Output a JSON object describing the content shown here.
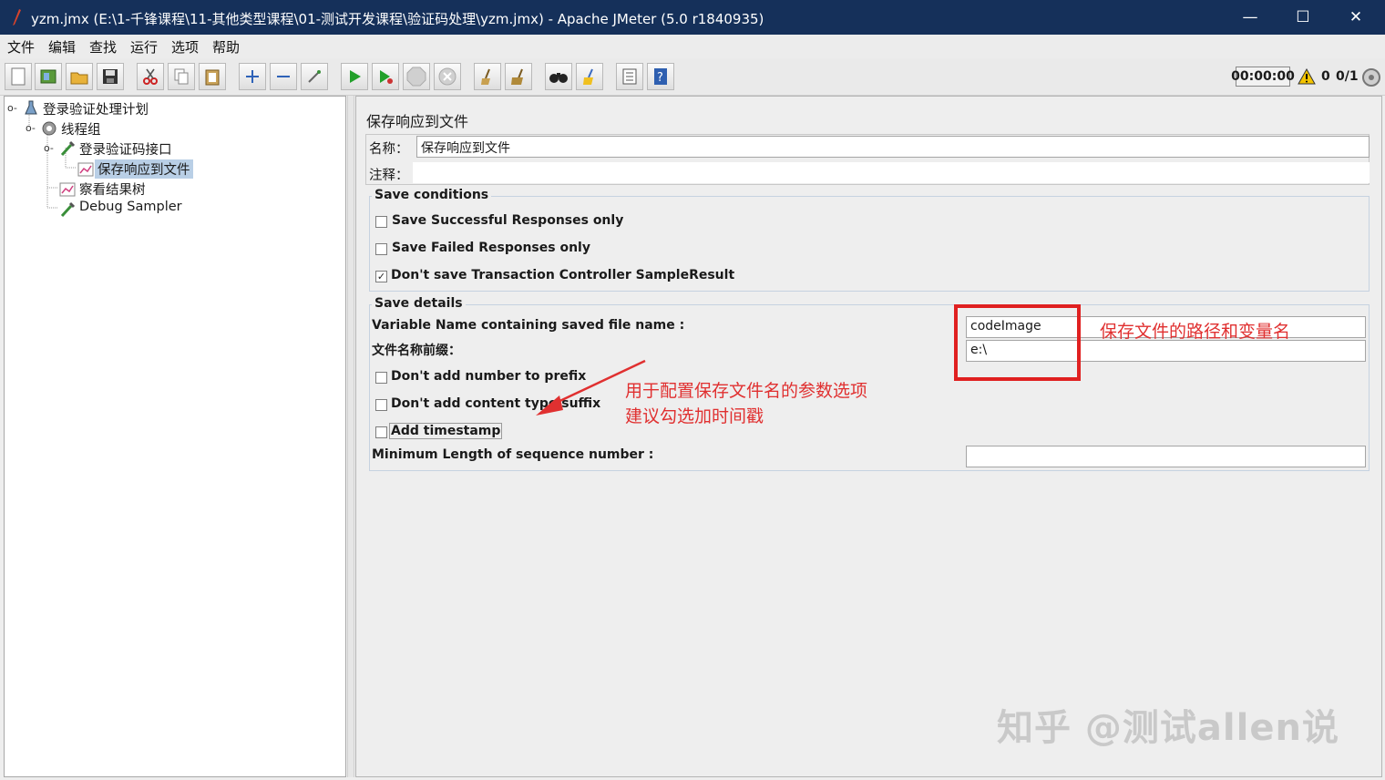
{
  "window": {
    "title": "yzm.jmx (E:\\1-千锋课程\\11-其他类型课程\\01-测试开发课程\\验证码处理\\yzm.jmx) - Apache JMeter (5.0 r1840935)",
    "minimize": "—",
    "maximize": "☐",
    "close": "✕"
  },
  "menu": [
    "文件",
    "编辑",
    "查找",
    "运行",
    "选项",
    "帮助"
  ],
  "toolbar": {
    "timer": "00:00:00",
    "warning_count": "0",
    "thread_count": "0/1"
  },
  "tree": {
    "nodes": [
      "登录验证处理计划",
      "线程组",
      "登录验证码接口",
      "保存响应到文件",
      "察看结果树",
      "Debug Sampler"
    ]
  },
  "panel": {
    "header": "保存响应到文件",
    "name_label": "名称：",
    "name_value": "保存响应到文件",
    "comment_label": "注释：",
    "save_conditions": {
      "legend": "Save conditions",
      "options": [
        {
          "label": "Save Successful Responses only",
          "checked": false
        },
        {
          "label": "Save Failed Responses only",
          "checked": false
        },
        {
          "label": "Don't save Transaction Controller SampleResult",
          "checked": true
        }
      ]
    },
    "save_details": {
      "legend": "Save details",
      "variable_name_label": "Variable Name containing saved file name :",
      "variable_name_value": "codeImage",
      "prefix_label": "文件名称前缀：",
      "prefix_value": "e:\\",
      "options": [
        {
          "label": "Don't add number to prefix",
          "checked": false
        },
        {
          "label": "Don't add content type suffix",
          "checked": false
        },
        {
          "label": "Add timestamp",
          "checked": false
        }
      ],
      "min_length_label": "Minimum Length of sequence number :",
      "min_length_value": ""
    }
  },
  "annotations": {
    "path_note": "保存文件的路径和变量名",
    "param_note_line1": "用于配置保存文件名的参数选项",
    "param_note_line2": "建议勾选加时间戳",
    "color": "#e03030"
  },
  "watermark": "知乎 @测试allen说"
}
